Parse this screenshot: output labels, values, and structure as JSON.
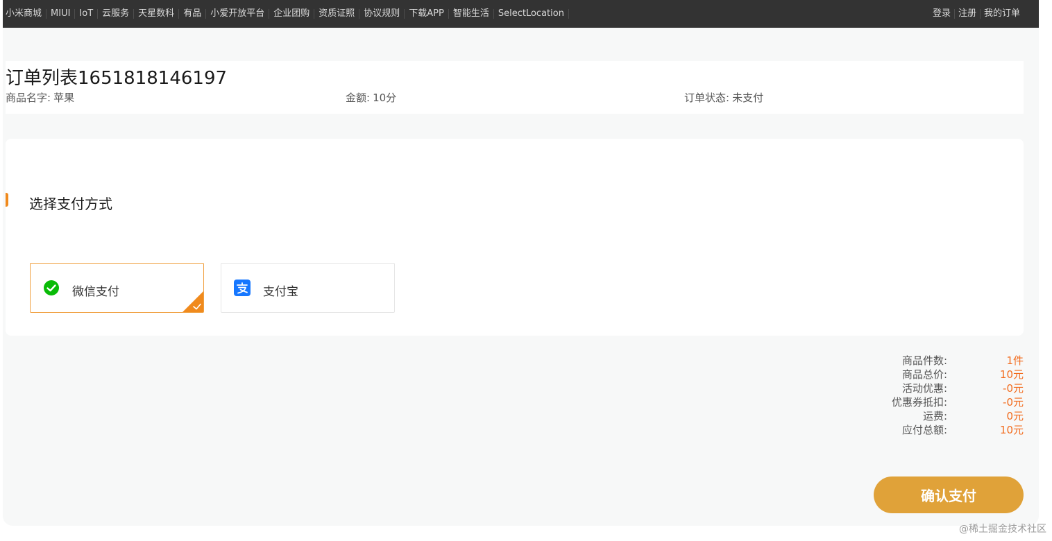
{
  "topnav": {
    "left_links": [
      "小米商城",
      "MIUI",
      "IoT",
      "云服务",
      "天星数科",
      "有品",
      "小爱开放平台",
      "企业团购",
      "资质证照",
      "协议规则",
      "下载APP",
      "智能生活",
      "SelectLocation"
    ],
    "right_links": [
      "登录",
      "注册",
      "我的订单"
    ]
  },
  "order": {
    "title": "订单列表1651818146197",
    "product_label": "商品名字:",
    "product_value": "苹果",
    "amount_label": "金额:",
    "amount_value": "10分",
    "status_label": "订单状态:",
    "status_value": "未支付"
  },
  "payment": {
    "heading": "选择支付方式",
    "options": [
      {
        "label": "微信支付",
        "icon": "wechat-pay-icon",
        "selected": true
      },
      {
        "label": "支付宝",
        "icon": "alipay-icon",
        "selected": false
      }
    ]
  },
  "summary": [
    {
      "label": "商品件数:",
      "value": "1件"
    },
    {
      "label": "商品总价:",
      "value": "10元"
    },
    {
      "label": "活动优惠:",
      "value": "-0元"
    },
    {
      "label": "优惠券抵扣:",
      "value": "-0元"
    },
    {
      "label": "运费:",
      "value": "0元"
    },
    {
      "label": "应付总额:",
      "value": "10元"
    }
  ],
  "confirm_label": "确认支付",
  "watermark": "@稀土掘金技术社区",
  "colors": {
    "accent": "#f08a1d",
    "price": "#f26b1d",
    "button": "#e0a239",
    "topbar": "#333333",
    "wechat": "#09bb07",
    "alipay": "#1677ff"
  }
}
